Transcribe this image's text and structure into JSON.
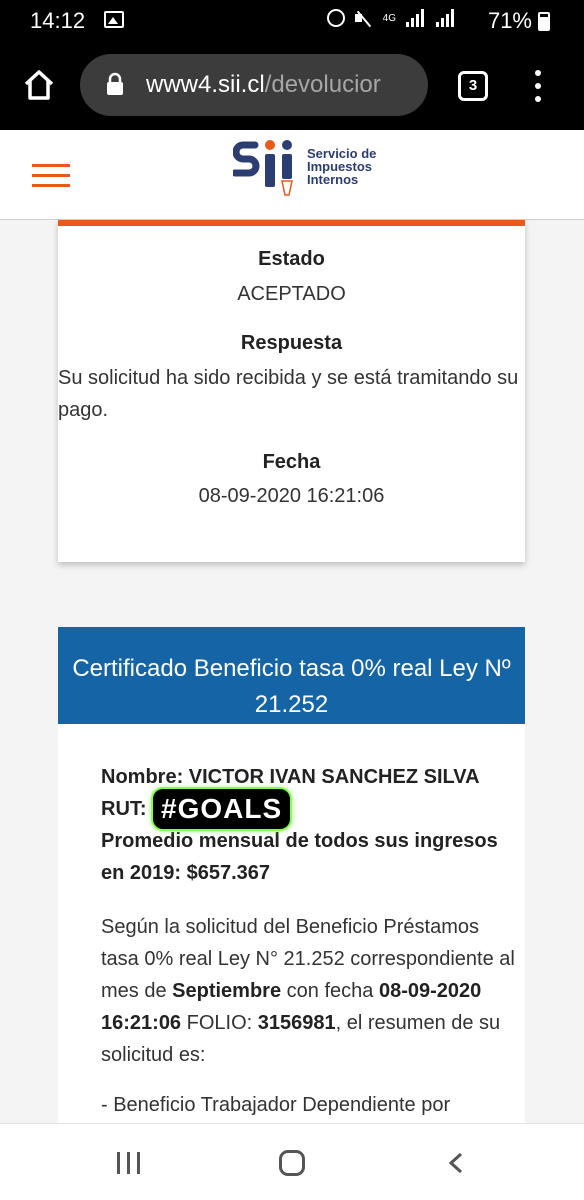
{
  "status_bar": {
    "time": "14:12",
    "network": "4G",
    "battery": "71%"
  },
  "browser": {
    "url_host": "www4.sii.cl",
    "url_path": "/devolucior",
    "tab_count": "3"
  },
  "site": {
    "logo_lines": [
      "Servicio de",
      "Impuestos",
      "Internos"
    ],
    "brand_color": "#e8591a",
    "accent_blue": "#1565a6"
  },
  "status_card": {
    "estado_label": "Estado",
    "estado_value": "ACEPTADO",
    "respuesta_label": "Respuesta",
    "respuesta_value": "Su solicitud ha sido recibida y se está tramitando su pago.",
    "fecha_label": "Fecha",
    "fecha_value": "08-09-2020 16:21:06"
  },
  "certificate": {
    "title": "Certificado Beneficio tasa 0% real Ley Nº 21.252",
    "nombre": "Nombre: VICTOR IVAN SANCHEZ SILVA",
    "rut_label": "RUT:",
    "sticker": "#GOALS",
    "promedio": "Promedio mensual de todos sus ingresos en 2019: $657.367",
    "p1": "Según la solicitud del Beneficio Préstamos tasa 0% real Ley N° 21.252 correspondiente al mes de",
    "mes": "Septiembre",
    "p2": "con fecha",
    "fecha": "08-09-2020 16:21:06",
    "p3": "FOLIO:",
    "folio": "3156981",
    "p4": ", el resumen de su solicitud es:",
    "item1": "- Beneficio Trabajador Dependiente por"
  }
}
